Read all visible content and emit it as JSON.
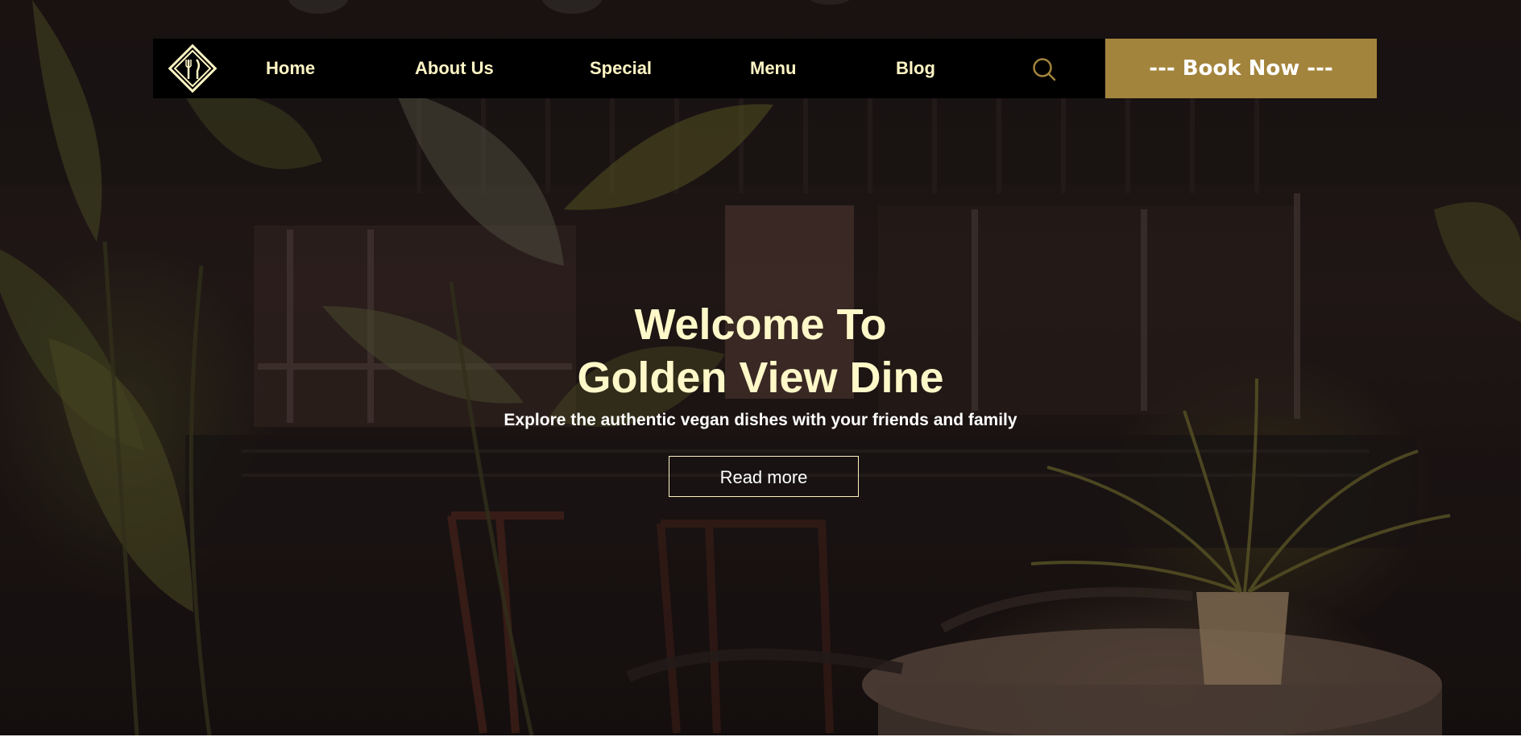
{
  "nav": {
    "logo_icon": "fork-knife-diamond-icon",
    "links": [
      {
        "label": "Home"
      },
      {
        "label": "About Us"
      },
      {
        "label": "Special"
      },
      {
        "label": "Menu"
      },
      {
        "label": "Blog"
      }
    ],
    "search_icon": "search-icon",
    "book_label": "--- Book Now ---"
  },
  "hero": {
    "title_line1": "Welcome To",
    "title_line2": "Golden View Dine",
    "subtitle": "Explore the authentic vegan dishes with your friends and family",
    "cta_label": "Read more"
  },
  "colors": {
    "nav_background": "#000000",
    "nav_text": "#fff5c4",
    "accent_gold": "#a3843c",
    "hero_title": "#fff8c9",
    "button_border": "#fff1c0"
  }
}
